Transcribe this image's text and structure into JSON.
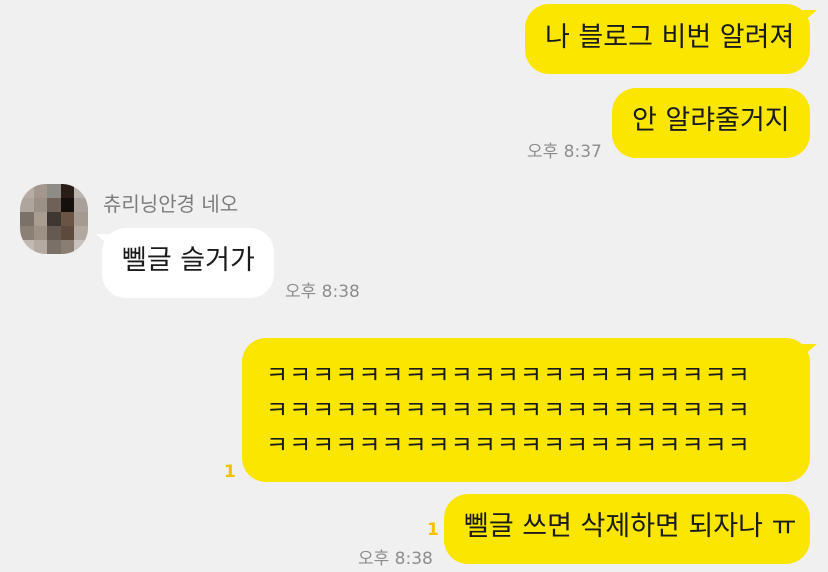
{
  "messages": {
    "m1": {
      "text": "나 블로그 비번 알려져"
    },
    "m2": {
      "text": "안 알랴줄거지",
      "time": "오후 8:37"
    },
    "m3": {
      "sender": "츄리닝안경 네오",
      "text": "뻴글 슬거가",
      "time": "오후 8:38"
    },
    "m4": {
      "lines": [
        "ㅋㅋㅋㅋㅋㅋㅋㅋㅋㅋㅋㅋㅋㅋㅋㅋㅋㅋㅋㅋㅋ",
        "ㅋㅋㅋㅋㅋㅋㅋㅋㅋㅋㅋㅋㅋㅋㅋㅋㅋㅋㅋㅋㅋ",
        "ㅋㅋㅋㅋㅋㅋㅋㅋㅋㅋㅋㅋㅋㅋㅋㅋㅋㅋㅋㅋㅋ"
      ],
      "unread": "1"
    },
    "m5": {
      "text": "뻴글 쓰면 삭제하면 되자나 ㅠ",
      "unread": "1",
      "time": "오후 8:38"
    }
  },
  "colors": {
    "background": "#f0f0f0",
    "my_bubble": "#fbe600",
    "other_bubble": "#ffffff",
    "unread": "#f2c200"
  },
  "icons": {
    "avatar": "pixelated-profile-photo"
  }
}
